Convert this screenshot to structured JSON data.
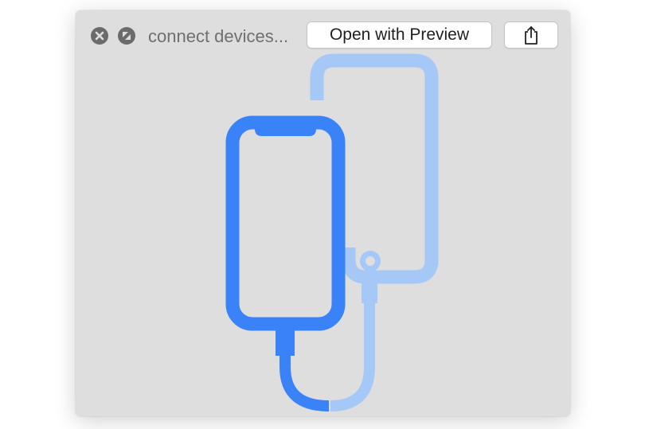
{
  "window": {
    "title": "connect devices...",
    "open_button_label": "Open with Preview"
  },
  "icons": {
    "close": "close-circle-icon",
    "fullscreen": "fullscreen-circle-icon",
    "share": "share-icon"
  },
  "illustration": {
    "subject": "two phones connected by a cable",
    "colors": {
      "new_device": "#3a82f7",
      "old_device": "#a5c8f7",
      "window_background": "#dedede"
    }
  }
}
